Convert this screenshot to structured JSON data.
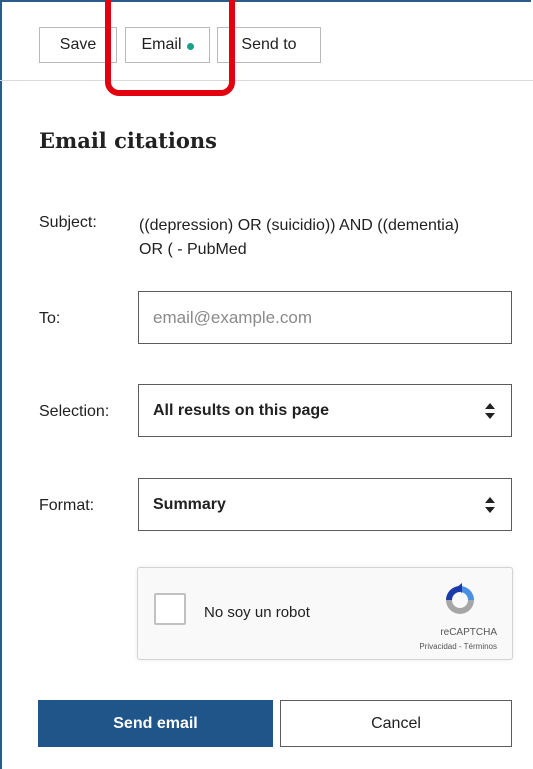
{
  "toolbar": {
    "save_label": "Save",
    "email_label": "Email",
    "send_to_label": "Send to",
    "email_dot_color": "#1b9f87"
  },
  "panel": {
    "title": "Email citations",
    "subject_label": "Subject:",
    "subject_value": "((depression) OR (suicidio)) AND ((dementia) OR ( - PubMed",
    "to_label": "To:",
    "to_placeholder": "email@example.com",
    "to_value": "",
    "selection_label": "Selection:",
    "selection_value": "All results on this page",
    "format_label": "Format:",
    "format_value": "Summary"
  },
  "captcha": {
    "label": "No soy un robot",
    "brand": "reCAPTCHA",
    "terms": "Privacidad - Términos",
    "icon": "recaptcha-logo"
  },
  "actions": {
    "send_label": "Send email",
    "cancel_label": "Cancel",
    "primary_color": "#20558a"
  },
  "annotation": {
    "highlight_color": "#e3000f"
  }
}
